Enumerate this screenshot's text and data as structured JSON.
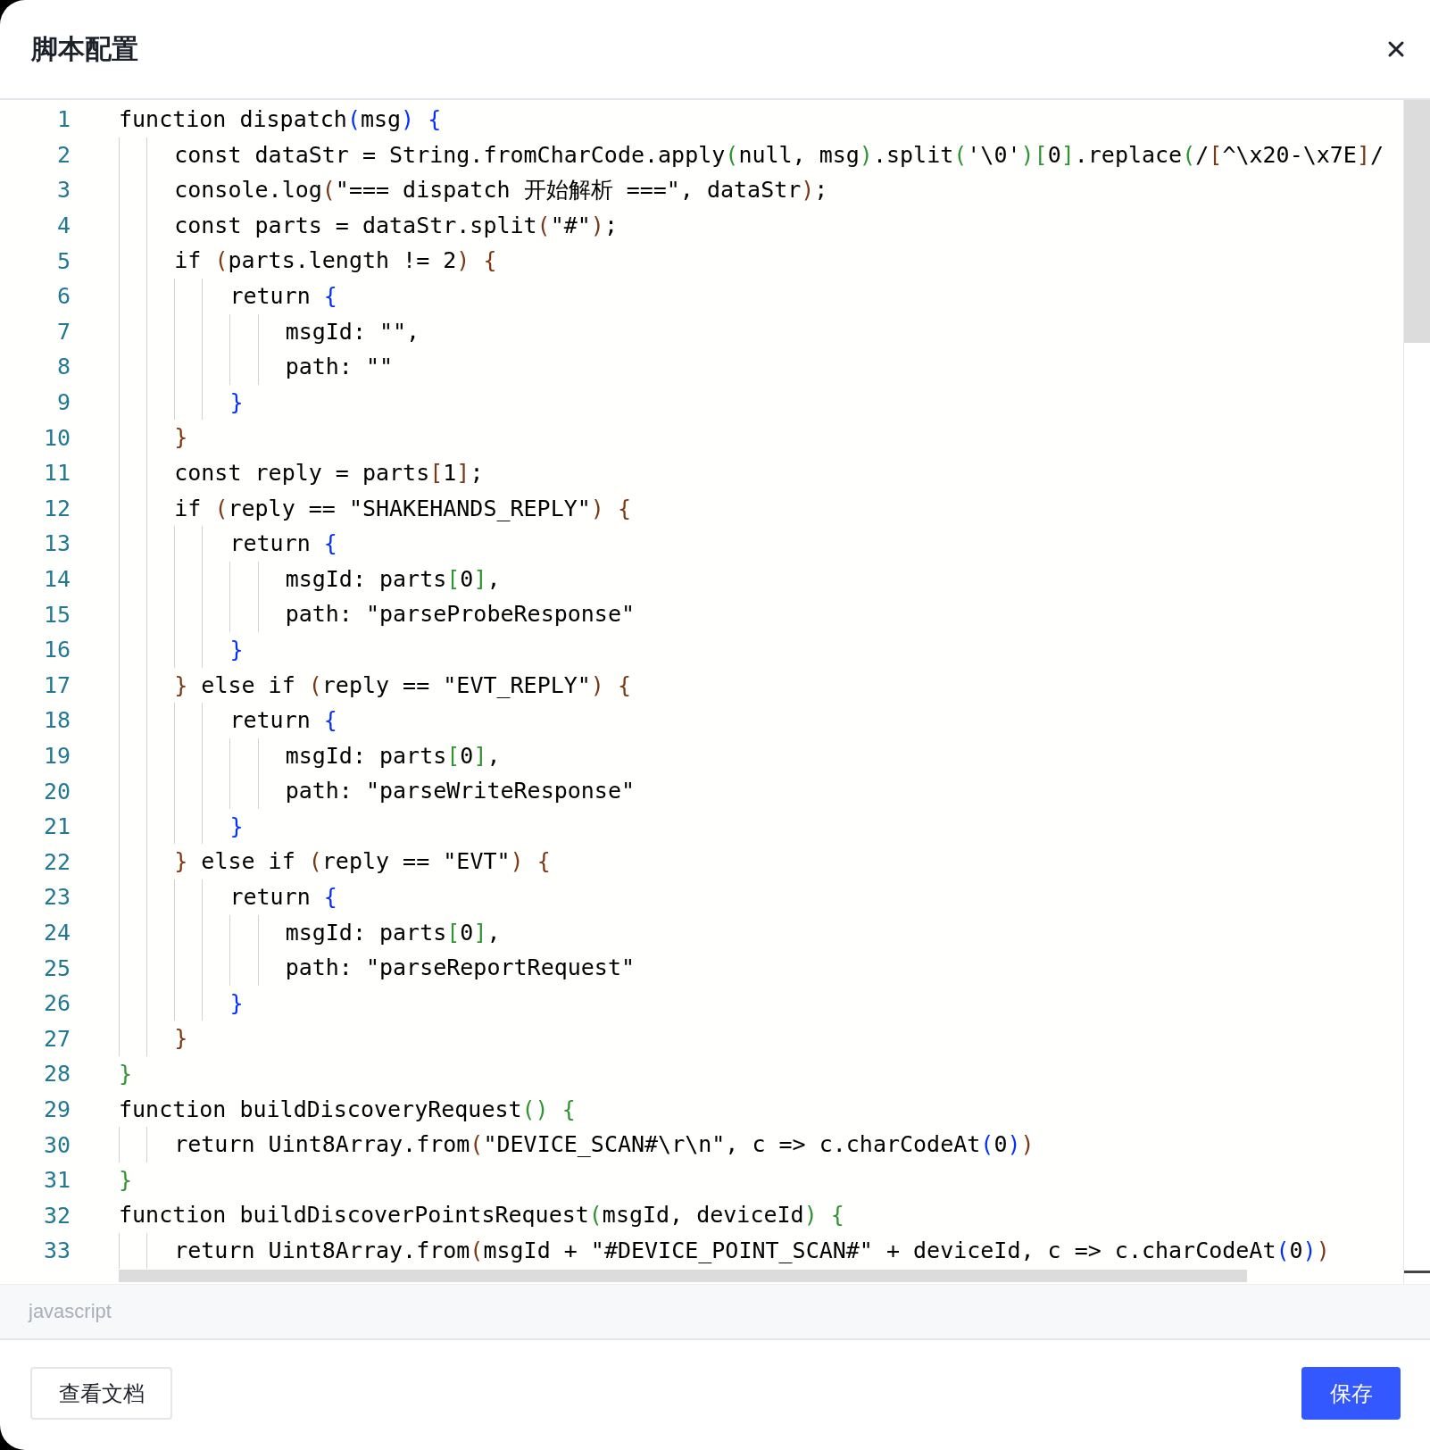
{
  "dialog": {
    "title": "脚本配置"
  },
  "editor": {
    "lines": [
      {
        "number": "1",
        "text": "function dispatch(msg) {"
      },
      {
        "number": "2",
        "text": "    const dataStr = String.fromCharCode.apply(null, msg).split('\\0')[0].replace(/[^\\x20-\\x7E]/"
      },
      {
        "number": "3",
        "text": "    console.log(\"=== dispatch 开始解析 ===\", dataStr);"
      },
      {
        "number": "4",
        "text": "    const parts = dataStr.split(\"#\");"
      },
      {
        "number": "5",
        "text": "    if (parts.length != 2) {"
      },
      {
        "number": "6",
        "text": "        return {"
      },
      {
        "number": "7",
        "text": "            msgId: \"\","
      },
      {
        "number": "8",
        "text": "            path: \"\""
      },
      {
        "number": "9",
        "text": "        }"
      },
      {
        "number": "10",
        "text": "    }"
      },
      {
        "number": "11",
        "text": "    const reply = parts[1];"
      },
      {
        "number": "12",
        "text": "    if (reply == \"SHAKEHANDS_REPLY\") {"
      },
      {
        "number": "13",
        "text": "        return {"
      },
      {
        "number": "14",
        "text": "            msgId: parts[0],"
      },
      {
        "number": "15",
        "text": "            path: \"parseProbeResponse\""
      },
      {
        "number": "16",
        "text": "        }"
      },
      {
        "number": "17",
        "text": "    } else if (reply == \"EVT_REPLY\") {"
      },
      {
        "number": "18",
        "text": "        return {"
      },
      {
        "number": "19",
        "text": "            msgId: parts[0],"
      },
      {
        "number": "20",
        "text": "            path: \"parseWriteResponse\""
      },
      {
        "number": "21",
        "text": "        }"
      },
      {
        "number": "22",
        "text": "    } else if (reply == \"EVT\") {"
      },
      {
        "number": "23",
        "text": "        return {"
      },
      {
        "number": "24",
        "text": "            msgId: parts[0],"
      },
      {
        "number": "25",
        "text": "            path: \"parseReportRequest\""
      },
      {
        "number": "26",
        "text": "        }"
      },
      {
        "number": "27",
        "text": "    }"
      },
      {
        "number": "28",
        "text": "}"
      },
      {
        "number": "29",
        "text": "function buildDiscoveryRequest() {"
      },
      {
        "number": "30",
        "text": "    return Uint8Array.from(\"DEVICE_SCAN#\\r\\n\", c => c.charCodeAt(0))"
      },
      {
        "number": "31",
        "text": "}"
      },
      {
        "number": "32",
        "text": "function buildDiscoverPointsRequest(msgId, deviceId) {"
      },
      {
        "number": "33",
        "text": "    return Uint8Array.from(msgId + \"#DEVICE_POINT_SCAN#\" + deviceId, c => c.charCodeAt(0))"
      }
    ],
    "language": "javascript"
  },
  "buttons": [
    {
      "label": "查看文档",
      "kind": "secondary"
    },
    {
      "label": "保存",
      "kind": "primary"
    }
  ]
}
